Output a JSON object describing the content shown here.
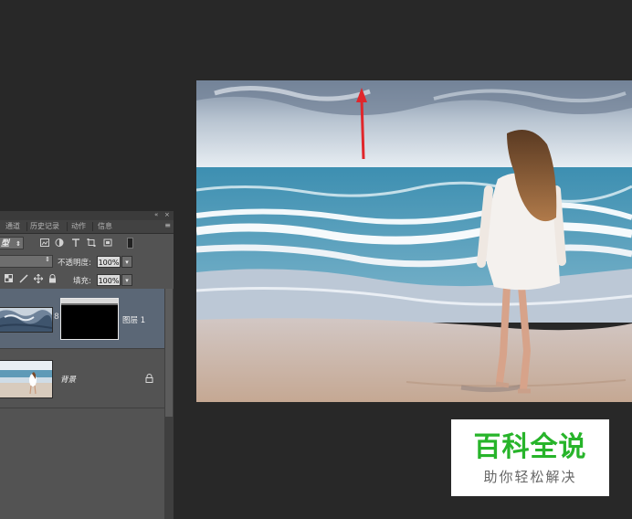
{
  "panel": {
    "collapse_glyph": "«",
    "close_glyph": "×",
    "menu_glyph": "≡",
    "tabs": [
      "通道",
      "历史记录",
      "动作",
      "信息"
    ],
    "kind_label": "型",
    "opacity_label": "不透明度:",
    "opacity_value": "100%",
    "fill_label": "填充:",
    "fill_value": "100%",
    "dropdown_glyph": "⇕",
    "stepper_glyph": "▾",
    "filter_icons": [
      "image-filter-icon",
      "adjustment-filter-icon",
      "type-filter-icon",
      "shape-filter-icon",
      "smart-object-filter-icon"
    ],
    "lock_icons": [
      "lock-transparent-icon",
      "lock-pixels-icon",
      "lock-position-icon",
      "lock-all-icon"
    ],
    "chain_glyph": "8"
  },
  "layers": [
    {
      "name": "图层 1",
      "selected": true,
      "has_mask": true
    },
    {
      "name": "背景",
      "selected": false,
      "locked": true,
      "lock_glyph": "🔒"
    }
  ],
  "watermark": {
    "title": "百科全说",
    "subtitle": "助你轻松解决"
  },
  "colors": {
    "app_background": "#282828",
    "panel_background": "#535353",
    "selected_layer": "#5b6776",
    "annotation_arrow": "#e0262b",
    "watermark_green": "#27b42a"
  }
}
